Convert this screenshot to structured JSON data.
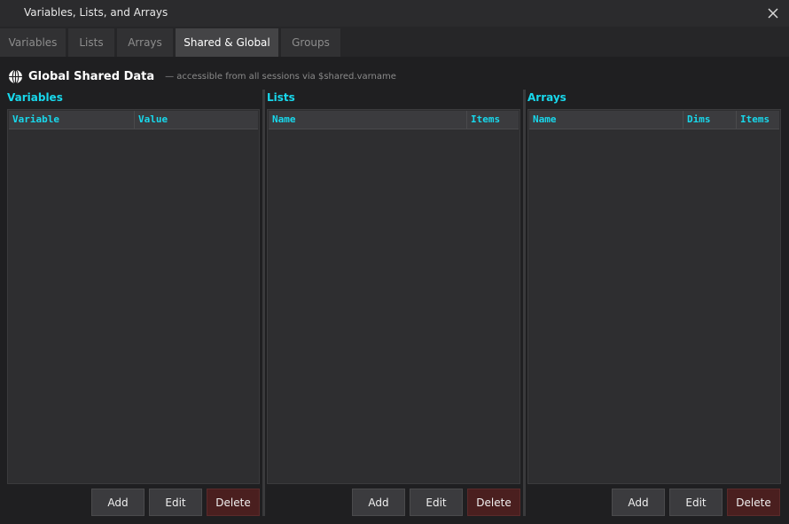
{
  "window": {
    "title": "Variables, Lists, and Arrays"
  },
  "tabs": [
    {
      "label": "Variables"
    },
    {
      "label": "Lists"
    },
    {
      "label": "Arrays"
    },
    {
      "label": "Shared & Global"
    },
    {
      "label": "Groups"
    }
  ],
  "header": {
    "title": "Global Shared Data",
    "subtitle": "— accessible from all sessions via $shared.varname"
  },
  "panels": {
    "variables": {
      "label": "Variables",
      "columns": [
        "Variable",
        "Value"
      ],
      "rows": [],
      "buttons": {
        "add": "Add",
        "edit": "Edit",
        "delete": "Delete"
      }
    },
    "lists": {
      "label": "Lists",
      "columns": [
        "Name",
        "Items"
      ],
      "rows": [],
      "buttons": {
        "add": "Add",
        "edit": "Edit",
        "delete": "Delete"
      }
    },
    "arrays": {
      "label": "Arrays",
      "columns": [
        "Name",
        "Dims",
        "Items"
      ],
      "rows": [],
      "buttons": {
        "add": "Add",
        "edit": "Edit",
        "delete": "Delete"
      }
    }
  },
  "colors": {
    "accent": "#18d8ec",
    "danger": "#4a1f1f",
    "background": "#1f1f21"
  }
}
